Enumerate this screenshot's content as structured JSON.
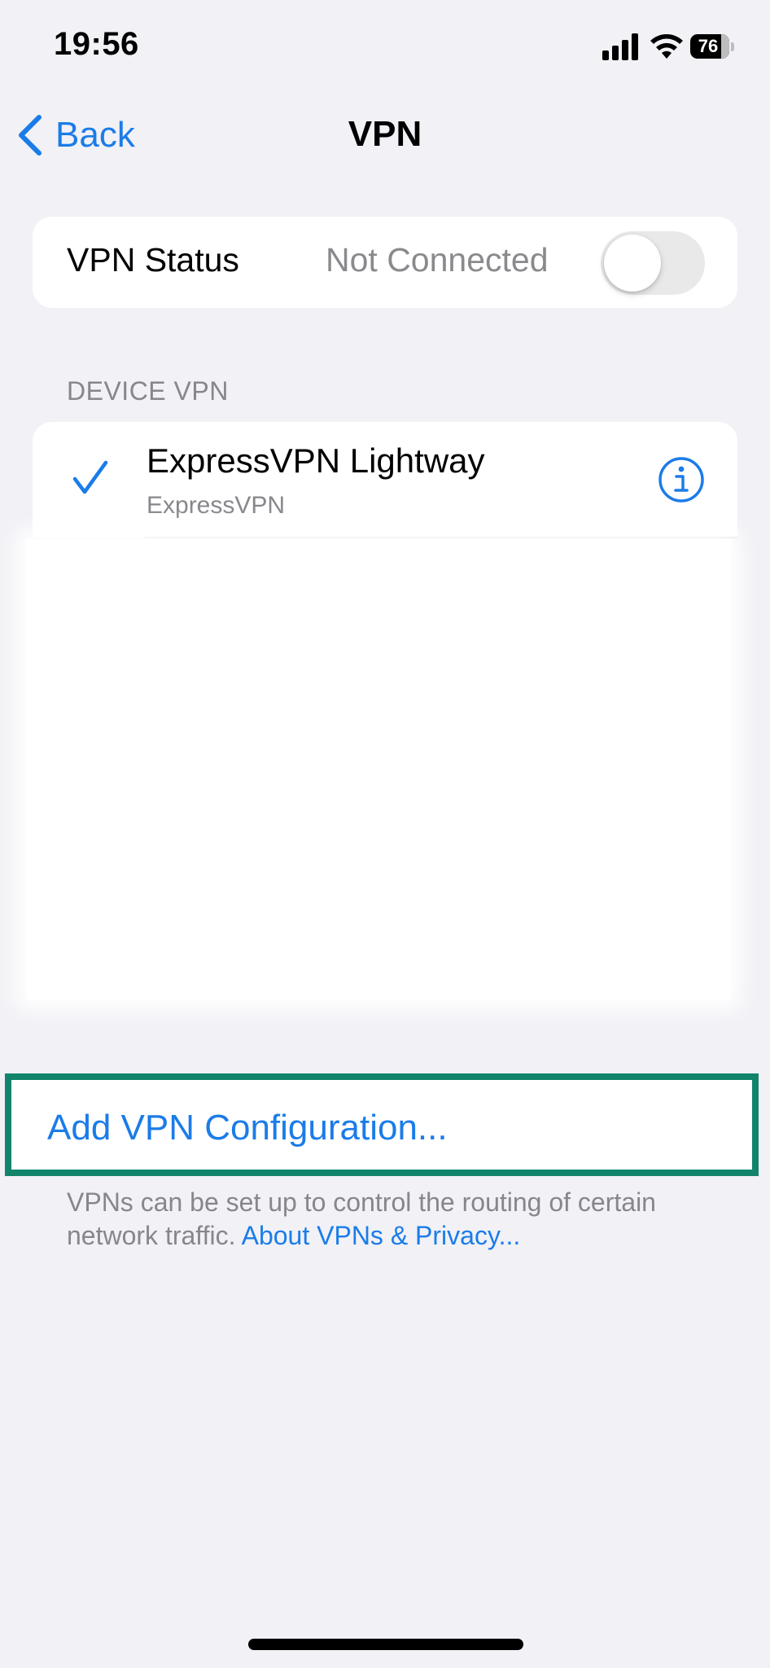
{
  "status_bar": {
    "time": "19:56",
    "battery_percent": "76",
    "signal_icon": "cellular-signal-icon",
    "wifi_icon": "wifi-icon",
    "battery_icon": "battery-icon"
  },
  "nav": {
    "back_label": "Back",
    "back_icon": "chevron-left-icon",
    "title": "VPN"
  },
  "vpn_status": {
    "label": "VPN Status",
    "value": "Not Connected",
    "toggle_on": false
  },
  "device_vpn": {
    "header": "DEVICE VPN",
    "items": [
      {
        "name": "ExpressVPN Lightway",
        "provider": "ExpressVPN",
        "selected": true,
        "check_icon": "checkmark-icon",
        "info_icon": "info-icon"
      }
    ]
  },
  "add_config": {
    "label": "Add VPN Configuration..."
  },
  "footer": {
    "text": "VPNs can be set up to control the routing of certain network traffic.",
    "link": "About VPNs & Privacy..."
  },
  "colors": {
    "background": "#f1f1f6",
    "accent": "#1b7ce8",
    "highlight_border": "#12846b",
    "secondary_text": "#86868b"
  }
}
